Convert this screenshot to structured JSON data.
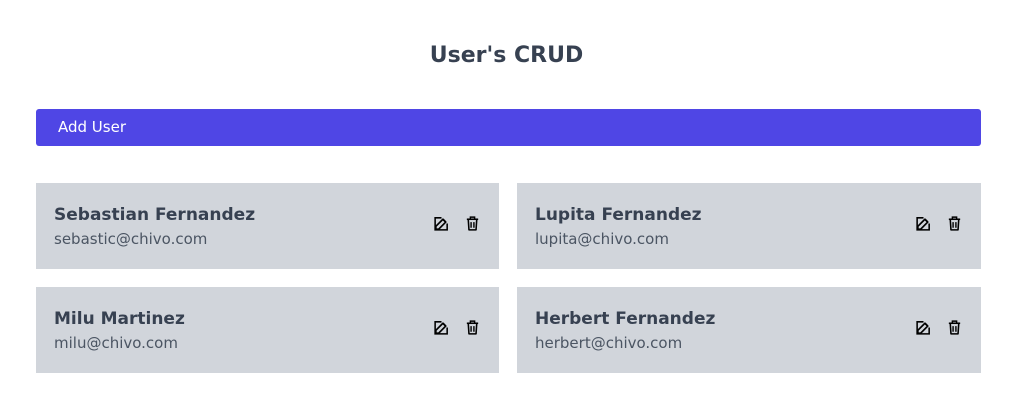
{
  "header": {
    "title": "User's CRUD"
  },
  "toolbar": {
    "add_user_label": "Add User"
  },
  "colors": {
    "accent": "#4f46e5",
    "card_background": "#d1d5db",
    "text": "#374151"
  },
  "icons": {
    "edit": "edit-icon",
    "delete": "trash-icon"
  },
  "users": [
    {
      "name": "Sebastian Fernandez",
      "email": "sebastic@chivo.com"
    },
    {
      "name": "Lupita Fernandez",
      "email": "lupita@chivo.com"
    },
    {
      "name": "Milu Martinez",
      "email": "milu@chivo.com"
    },
    {
      "name": "Herbert Fernandez",
      "email": "herbert@chivo.com"
    }
  ]
}
